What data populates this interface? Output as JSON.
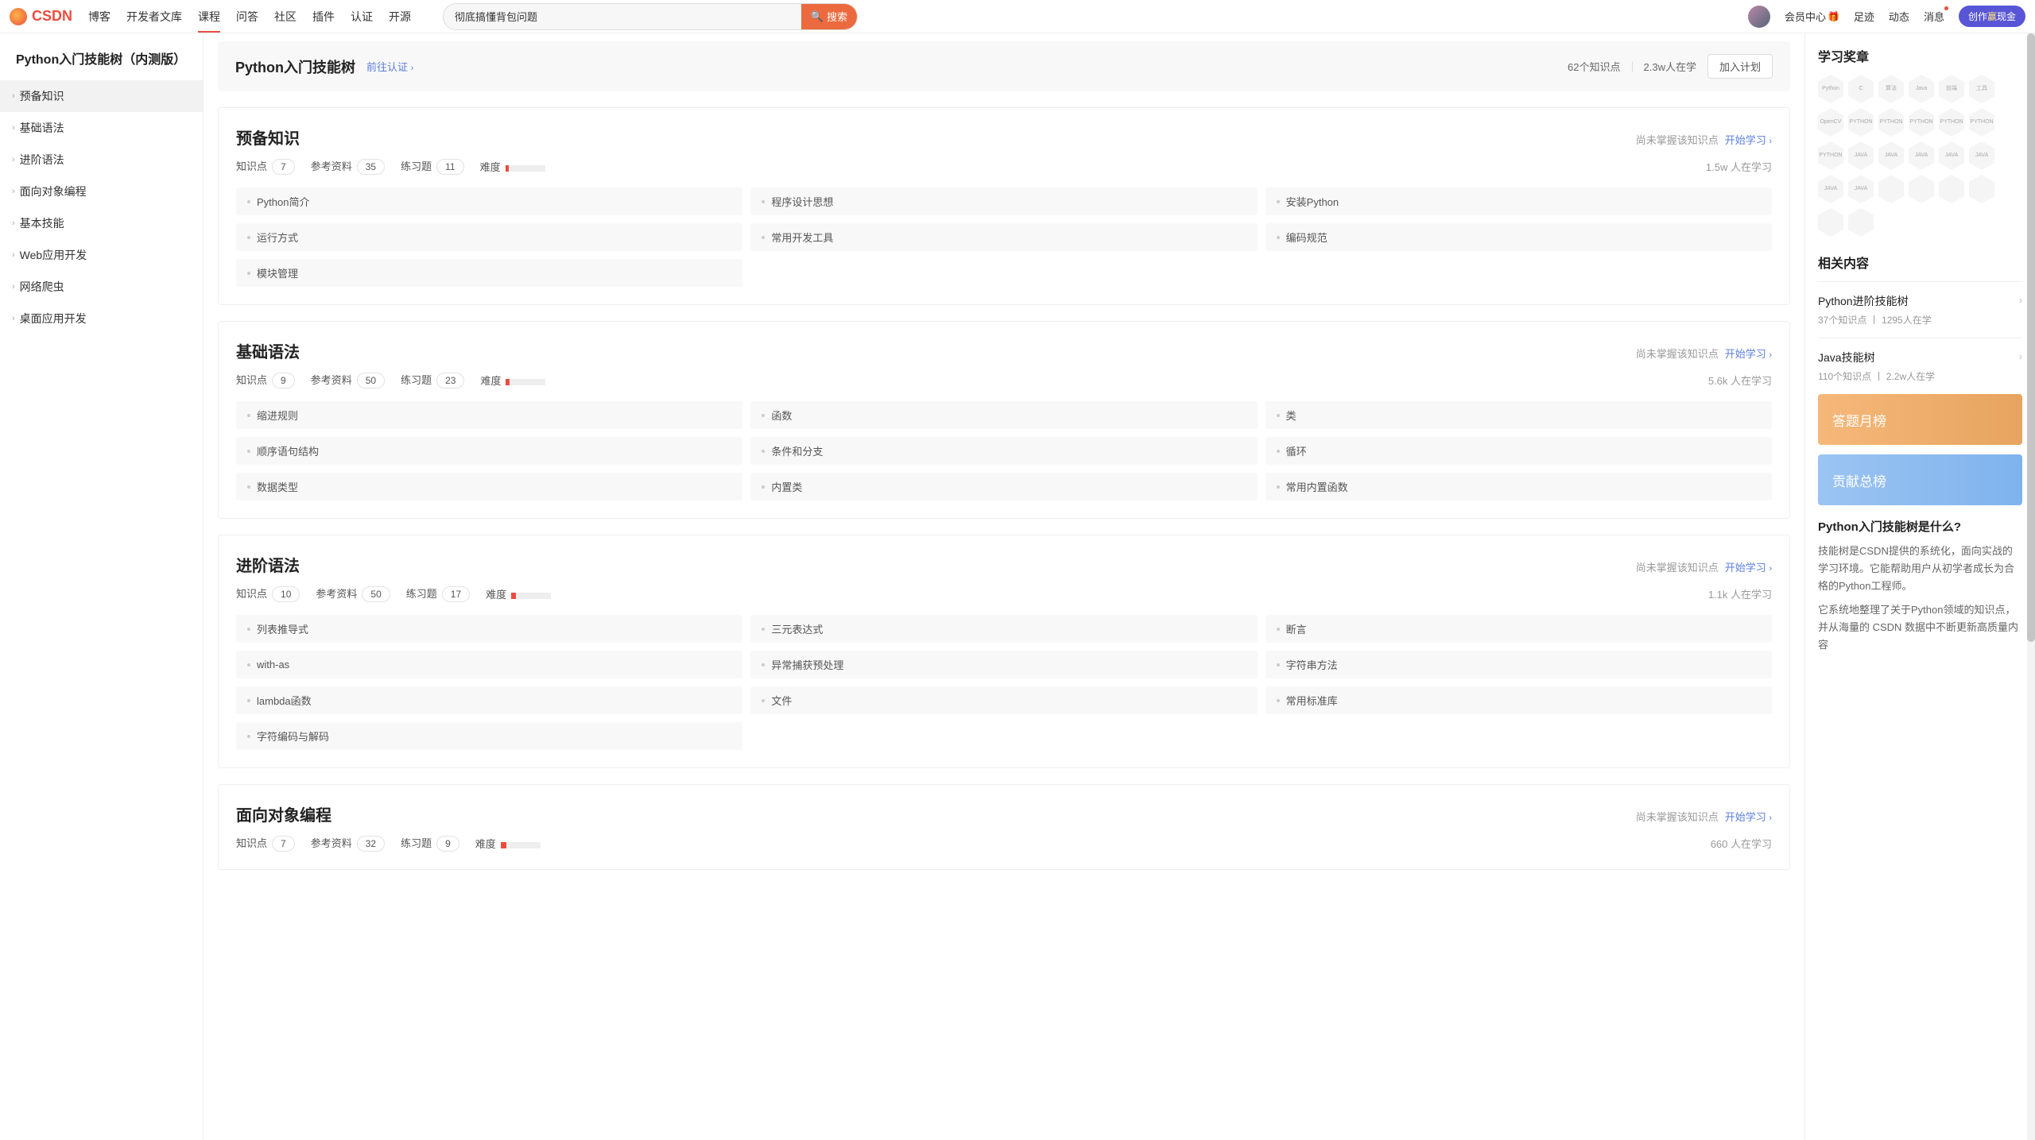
{
  "header": {
    "logo": "CSDN",
    "nav": [
      "博客",
      "开发者文库",
      "课程",
      "问答",
      "社区",
      "插件",
      "认证",
      "开源"
    ],
    "nav_active_index": 2,
    "search_value": "彻底搞懂背包问题",
    "search_btn": "搜索",
    "right_links": {
      "member": "会员中心",
      "footprint": "足迹",
      "activity": "动态",
      "message": "消息"
    },
    "pill_prefix": "创作",
    "pill_mid": "赢",
    "pill_suffix": "现金"
  },
  "sidebar": {
    "title": "Python入门技能树（内测版）",
    "items": [
      "预备知识",
      "基础语法",
      "进阶语法",
      "面向对象编程",
      "基本技能",
      "Web应用开发",
      "网络爬虫",
      "桌面应用开发"
    ],
    "selected_index": 0
  },
  "hero": {
    "title": "Python入门技能树",
    "cert_link": "前往认证",
    "kp_count": "62个知识点",
    "learners": "2.3w人在学",
    "join_btn": "加入计划"
  },
  "labels": {
    "kp": "知识点",
    "refs": "参考资料",
    "ex": "练习题",
    "diff": "难度",
    "not_mastered": "尚未掌握该知识点",
    "start_learn": "开始学习"
  },
  "sections": [
    {
      "title": "预备知识",
      "kp": "7",
      "refs": "35",
      "ex": "11",
      "diff_pct": 8,
      "learners": "1.5w 人在学习",
      "topics": [
        "Python简介",
        "程序设计思想",
        "安装Python",
        "运行方式",
        "常用开发工具",
        "编码规范",
        "模块管理"
      ]
    },
    {
      "title": "基础语法",
      "kp": "9",
      "refs": "50",
      "ex": "23",
      "diff_pct": 10,
      "learners": "5.6k 人在学习",
      "topics": [
        "缩进规则",
        "函数",
        "类",
        "顺序语句结构",
        "条件和分支",
        "循环",
        "数据类型",
        "内置类",
        "常用内置函数"
      ]
    },
    {
      "title": "进阶语法",
      "kp": "10",
      "refs": "50",
      "ex": "17",
      "diff_pct": 12,
      "learners": "1.1k 人在学习",
      "topics": [
        "列表推导式",
        "三元表达式",
        "断言",
        "with-as",
        "异常捕获预处理",
        "字符串方法",
        "lambda函数",
        "文件",
        "常用标准库",
        "字符编码与解码"
      ]
    },
    {
      "title": "面向对象编程",
      "kp": "7",
      "refs": "32",
      "ex": "9",
      "diff_pct": 14,
      "learners": "660 人在学习",
      "topics": []
    }
  ],
  "aside": {
    "badges_title": "学习奖章",
    "badge_labels": [
      "Python",
      "C",
      "算法",
      "Java",
      "前端",
      "工具",
      "OpenCV",
      "PYTHON",
      "PYTHON",
      "PYTHON",
      "PYTHON",
      "PYTHON",
      "PYTHON",
      "JAVA",
      "JAVA",
      "JAVA",
      "JAVA",
      "JAVA",
      "JAVA",
      "JAVA",
      "",
      "",
      " ",
      " ",
      " ",
      " "
    ],
    "related_title": "相关内容",
    "related": [
      {
        "title": "Python进阶技能树",
        "meta": "37个知识点  丨  1295人在学"
      },
      {
        "title": "Java技能树",
        "meta": "110个知识点  丨  2.2w人在学"
      }
    ],
    "banner_orange": "答题月榜",
    "banner_blue": "贡献总榜",
    "intro_title": "Python入门技能树是什么?",
    "intro_p1": "技能树是CSDN提供的系统化，面向实战的学习环境。它能帮助用户从初学者成长为合格的Python工程师。",
    "intro_p2": "它系统地整理了关于Python领域的知识点，并从海量的 CSDN 数据中不断更新高质量内容"
  }
}
